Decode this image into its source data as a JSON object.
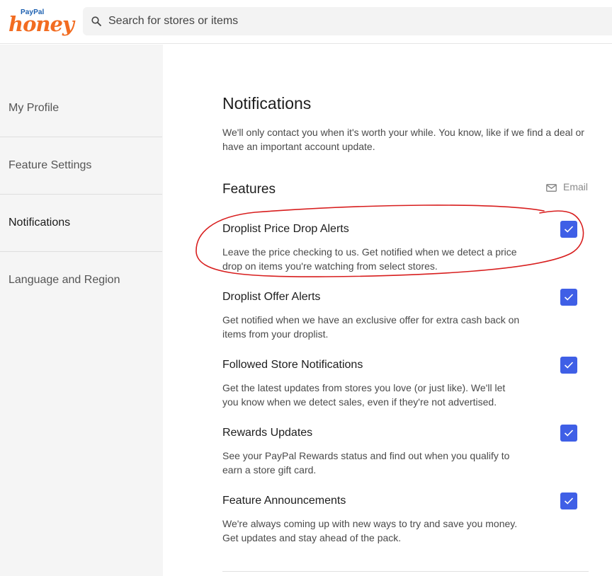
{
  "brand": {
    "paypal": "PayPal",
    "name": "honey"
  },
  "search": {
    "placeholder": "Search for stores or items"
  },
  "sidebar": {
    "items": [
      {
        "label": "My Profile"
      },
      {
        "label": "Feature Settings"
      },
      {
        "label": "Notifications",
        "active": true
      },
      {
        "label": "Language and Region"
      }
    ]
  },
  "page": {
    "title": "Notifications",
    "intro": "We'll only contact you when it's worth your while. You know, like if we find a deal or have an important account update.",
    "section_title": "Features",
    "column_label": "Email"
  },
  "features": [
    {
      "title": "Droplist Price Drop Alerts",
      "description": "Leave the price checking to us. Get notified when we detect a price drop on items you're watching from select stores.",
      "email_checked": true,
      "highlighted": true
    },
    {
      "title": "Droplist Offer Alerts",
      "description": "Get notified when we have an exclusive offer for extra cash back on items from your droplist.",
      "email_checked": true
    },
    {
      "title": "Followed Store Notifications",
      "description": "Get the latest updates from stores you love (or just like). We'll let you know when we detect sales, even if they're not advertised.",
      "email_checked": true
    },
    {
      "title": "Rewards Updates",
      "description": "See your PayPal Rewards status and find out when you qualify to earn a store gift card.",
      "email_checked": true
    },
    {
      "title": "Feature Announcements",
      "description": "We're always coming up with new ways to try and save you money. Get updates and stay ahead of the pack.",
      "email_checked": true
    }
  ],
  "colors": {
    "accent": "#3f5fe6",
    "brand": "#f26c21",
    "annotation": "#d81e1e"
  },
  "icons": {
    "search": "search-icon",
    "email": "mail-icon",
    "check": "checkmark-icon"
  }
}
